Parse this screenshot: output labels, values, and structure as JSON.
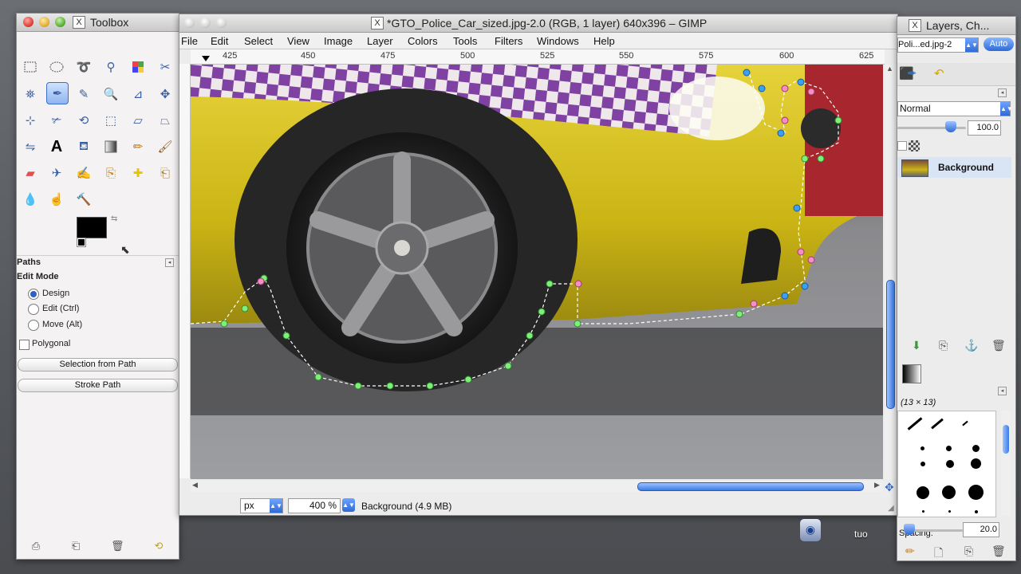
{
  "toolbox": {
    "title": "Toolbox",
    "paths_label": "Paths",
    "edit_mode_label": "Edit Mode",
    "modes": [
      "Design",
      "Edit (Ctrl)",
      "Move (Alt)"
    ],
    "polygonal_label": "Polygonal",
    "selection_from_path": "Selection from Path",
    "stroke_path": "Stroke Path"
  },
  "image_window": {
    "title": "*GTO_Police_Car_sized.jpg-2.0 (RGB, 1 layer) 640x396 – GIMP",
    "menus": [
      "File",
      "Edit",
      "Select",
      "View",
      "Image",
      "Layer",
      "Colors",
      "Tools",
      "Filters",
      "Windows",
      "Help"
    ],
    "ruler_ticks": [
      "425",
      "450",
      "475",
      "500",
      "525",
      "550",
      "575",
      "600",
      "625"
    ],
    "unit": "px",
    "zoom": "400 %",
    "status": "Background (4.9 MB)"
  },
  "layers_dock": {
    "title": "Layers, Ch...",
    "image_select": "Poli...ed.jpg-2",
    "auto_label": "Auto",
    "mode": "Normal",
    "opacity": "100.0",
    "layer_name": "Background",
    "brush_info": "(13 × 13)",
    "spacing_label": "Spacing:",
    "spacing_value": "20.0"
  },
  "overlay": {
    "truncated_label": "tuo"
  },
  "colors": {
    "accent": "#3c7be6",
    "car_yellow": "#d9c51a",
    "path_green": "#7ef07a",
    "path_pink": "#f28fc4"
  }
}
